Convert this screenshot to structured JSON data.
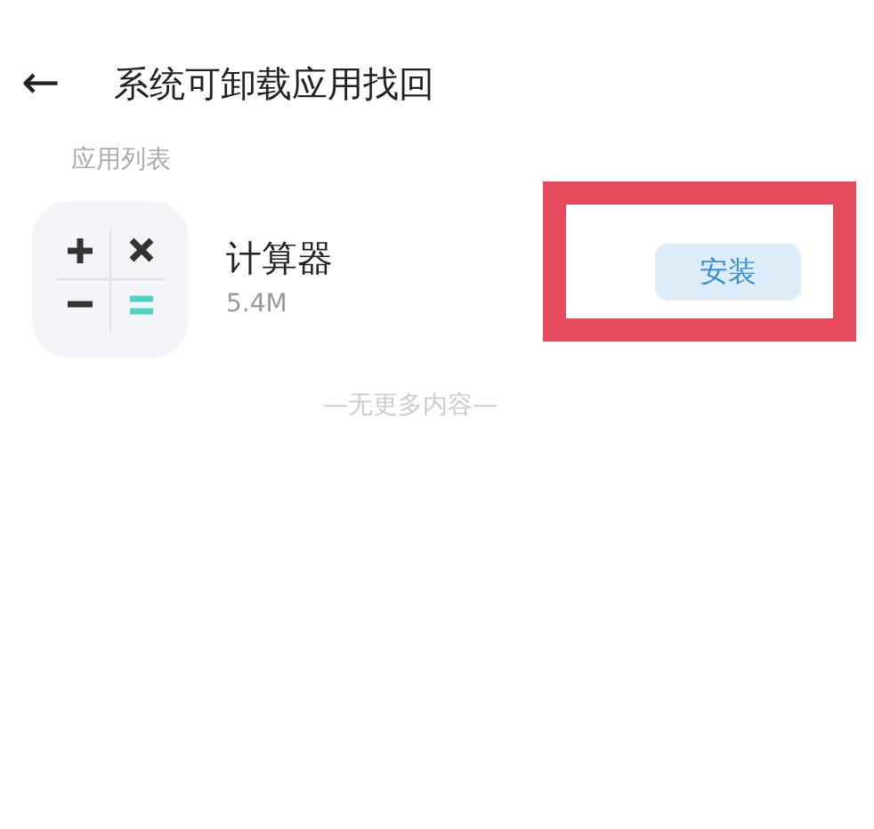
{
  "header": {
    "back": "←",
    "title": "系统可卸载应用找回"
  },
  "section_label": "应用列表",
  "apps": [
    {
      "name": "计算器",
      "size": "5.4M",
      "action": "安装",
      "highlighted": true
    }
  ],
  "footer": "—无更多内容—"
}
